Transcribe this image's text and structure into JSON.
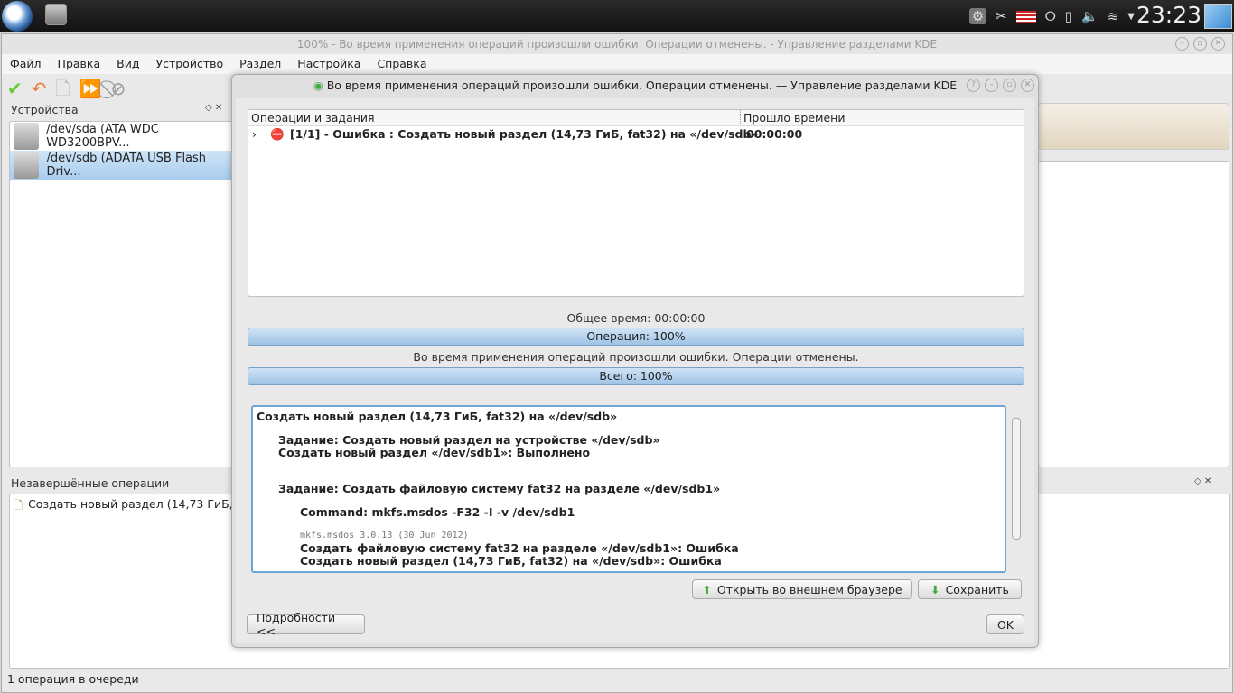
{
  "panel": {
    "clock": "23:23"
  },
  "main": {
    "title": "100% - Во время применения операций произошли ошибки. Операции отменены. - Управление разделами KDE",
    "menu": [
      "Файл",
      "Правка",
      "Вид",
      "Устройство",
      "Раздел",
      "Настройка",
      "Справка"
    ],
    "devices_title": "Устройства",
    "devices": [
      "/dev/sda (ATA WDC WD3200BPV...",
      "/dev/sdb (ADATA USB Flash Driv..."
    ],
    "pending_title": "Незавершённые операции",
    "pending": [
      "Создать новый раздел (14,73 ГиБ,"
    ],
    "status": "1 операция в очереди"
  },
  "dialog": {
    "title": "Во время применения операций произошли ошибки. Операции отменены. — Управление разделами KDE",
    "col_ops": "Операции и задания",
    "col_time": "Прошло времени",
    "row": {
      "text": "[1/1] - Ошибка : Создать новый раздел (14,73 ГиБ, fat32) на «/dev/sdb»",
      "time": "00:00:00"
    },
    "total_time": "Общее время: 00:00:00",
    "op_progress": "Операция: 100%",
    "op_percent": 100,
    "message": "Во время применения операций произошли ошибки. Операции отменены.",
    "total_progress": "Всего: 100%",
    "total_percent": 100,
    "log": {
      "l1": "Создать новый раздел (14,73 ГиБ, fat32) на «/dev/sdb»",
      "l2": "Задание: Создать новый раздел на устройстве «/dev/sdb»",
      "l3": "Создать новый раздел «/dev/sdb1»: Выполнено",
      "l4": "Задание: Создать файловую систему fat32 на разделе «/dev/sdb1»",
      "l5": "Command: mkfs.msdos -F32 -I -v /dev/sdb1",
      "l6": "mkfs.msdos 3.0.13 (30 Jun 2012)",
      "l7": "Создать файловую систему fat32 на разделе «/dev/sdb1»: Ошибка",
      "l8": "Создать новый раздел (14,73 ГиБ, fat32) на «/dev/sdb»: Ошибка"
    },
    "open_browser": "Открыть во внешнем браузере",
    "save": "Сохранить",
    "details": "Подробности <<",
    "ok": "OK"
  }
}
